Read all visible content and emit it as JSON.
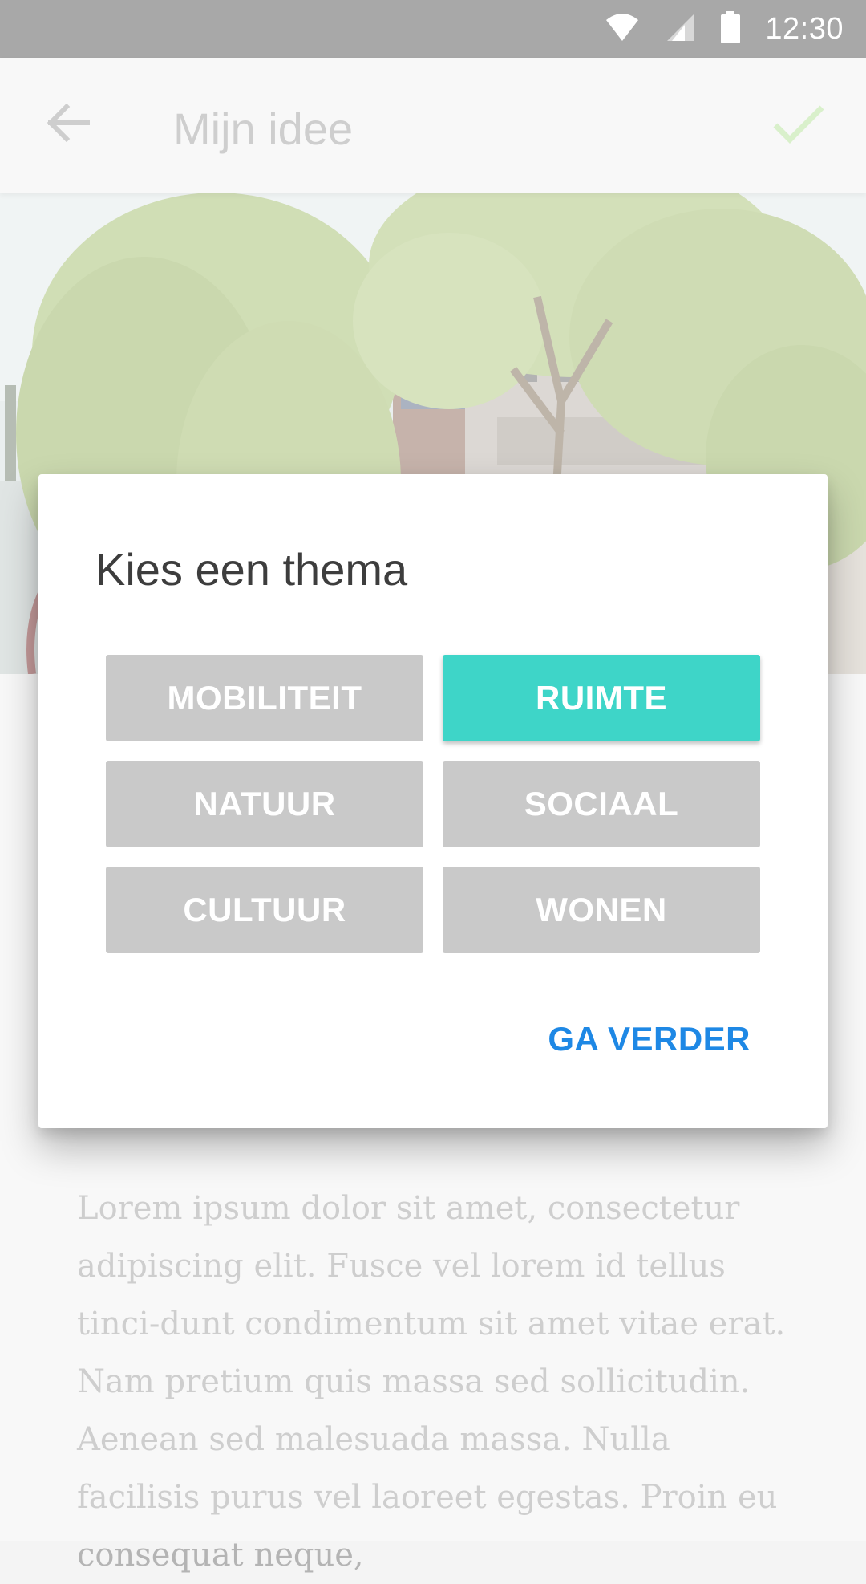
{
  "status_bar": {
    "time": "12:30",
    "icons": [
      "wifi-icon",
      "signal-icon",
      "battery-icon"
    ]
  },
  "app_bar": {
    "title": "Mijn idee",
    "back_icon": "arrow-left-icon",
    "confirm_icon": "check-icon",
    "confirm_color": "#c5e8b0"
  },
  "dialog": {
    "title": "Kies een thema",
    "themes": [
      {
        "label": "MOBILITEIT",
        "selected": false
      },
      {
        "label": "RUIMTE",
        "selected": true
      },
      {
        "label": "NATUUR",
        "selected": false
      },
      {
        "label": "SOCIAAL",
        "selected": false
      },
      {
        "label": "CULTUUR",
        "selected": false
      },
      {
        "label": "WONEN",
        "selected": false
      }
    ],
    "continue_label": "GA VERDER",
    "selected_color": "#3ed5c8",
    "unselected_color": "#c9c9c9",
    "action_color": "#1e88e5"
  },
  "body_text": "Lorem ipsum dolor sit amet, consectetur adipiscing elit. Fusce vel lorem id tellus tinci-dunt condimentum sit amet vitae erat. Nam pretium quis massa sed sollicitudin. Aenean sed malesuada massa. Nulla facilisis purus vel laoreet egestas. Proin eu consequat neque,"
}
